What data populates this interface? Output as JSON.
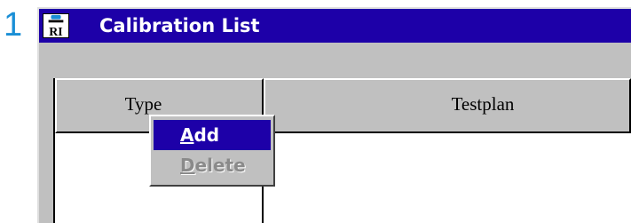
{
  "step": {
    "number": "1"
  },
  "window": {
    "title": "Calibration List",
    "icon": "ri-app-icon",
    "title_bar_color": "#1d00a8"
  },
  "grid": {
    "columns": [
      {
        "label": "Type"
      },
      {
        "label": "Testplan"
      }
    ],
    "rows": []
  },
  "context_menu": {
    "items": [
      {
        "accel": "A",
        "rest": "dd",
        "label": "Add",
        "state": "selected"
      },
      {
        "accel": "D",
        "rest": "elete",
        "label": "Delete",
        "state": "disabled"
      }
    ]
  }
}
